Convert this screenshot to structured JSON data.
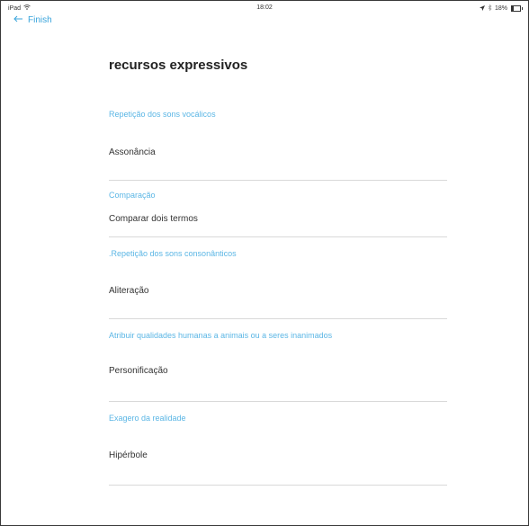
{
  "status": {
    "device": "iPad",
    "time": "18:02",
    "battery": "18%",
    "battery_level": 0.18
  },
  "nav": {
    "back_label": "Finish"
  },
  "title": "recursos expressivos",
  "items": [
    {
      "question": "Repetição dos sons vocálicos",
      "answer": "Assonância"
    },
    {
      "question": "Comparação",
      "answer": "Comparar dois termos"
    },
    {
      "question": ".Repetição dos sons consonânticos",
      "answer": "Aliteração"
    },
    {
      "question": "Atribuir qualidades humanas a animais ou a seres inanimados",
      "answer": "Personificação"
    },
    {
      "question": "Exagero da realidade",
      "answer": "Hipérbole"
    }
  ]
}
